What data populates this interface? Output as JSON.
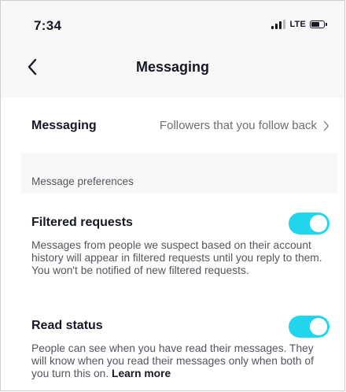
{
  "status_bar": {
    "time": "7:34",
    "network": "LTE",
    "icons": [
      "signal-icon",
      "battery-icon"
    ]
  },
  "nav": {
    "back_icon": "chevron-left-icon",
    "title": "Messaging"
  },
  "messaging_row": {
    "label": "Messaging",
    "value": "Followers that you follow back",
    "chevron": "chevron-right-icon"
  },
  "section_header": "Message preferences",
  "preferences": [
    {
      "title": "Filtered requests",
      "description": "Messages from people we suspect based on their account history will appear in filtered requests until you reply to them. You won't be notified of new filtered requests.",
      "enabled": true
    },
    {
      "title": "Read status",
      "description": "People can see when you have read their messages. They will know when you read their messages only when both of you turn this on.",
      "link": "Learn more",
      "enabled": true
    }
  ],
  "colors": {
    "accent": "#20d5ec",
    "background": "#f8f8f8",
    "card": "#ffffff",
    "text": "#161823",
    "secondary_text": "#54565e"
  }
}
